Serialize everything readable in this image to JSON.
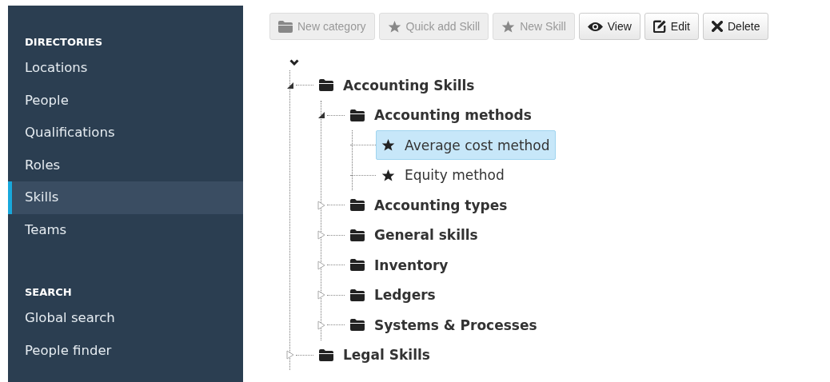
{
  "sidebar": {
    "sections": [
      {
        "heading": "DIRECTORIES",
        "items": [
          {
            "label": "Locations",
            "selected": false
          },
          {
            "label": "People",
            "selected": false
          },
          {
            "label": "Qualifications",
            "selected": false
          },
          {
            "label": "Roles",
            "selected": false
          },
          {
            "label": "Skills",
            "selected": true
          },
          {
            "label": "Teams",
            "selected": false
          }
        ]
      },
      {
        "heading": "SEARCH",
        "items": [
          {
            "label": "Global search",
            "selected": false
          },
          {
            "label": "People finder",
            "selected": false
          }
        ]
      }
    ]
  },
  "toolbar": {
    "buttons": [
      {
        "label": "New category",
        "kind": "new-category",
        "disabled": true
      },
      {
        "label": "Quick add Skill",
        "kind": "quick-add",
        "disabled": true
      },
      {
        "label": "New Skill",
        "kind": "new",
        "disabled": true
      },
      {
        "label": "View",
        "kind": "view",
        "disabled": false
      },
      {
        "label": "Edit",
        "kind": "edit",
        "disabled": false
      },
      {
        "label": "Delete",
        "kind": "delete",
        "disabled": false
      }
    ]
  },
  "tree": [
    {
      "label": "Accounting Skills",
      "kind": "category",
      "expanded": true,
      "selected": false,
      "children": [
        {
          "label": "Accounting methods",
          "kind": "category",
          "expanded": true,
          "selected": false,
          "children": [
            {
              "label": "Average cost method",
              "kind": "skill",
              "selected": true
            },
            {
              "label": "Equity method",
              "kind": "skill",
              "selected": false
            }
          ]
        },
        {
          "label": "Accounting types",
          "kind": "category",
          "expanded": false,
          "selected": false
        },
        {
          "label": "General skills",
          "kind": "category",
          "expanded": false,
          "selected": false
        },
        {
          "label": "Inventory",
          "kind": "category",
          "expanded": false,
          "selected": false
        },
        {
          "label": "Ledgers",
          "kind": "category",
          "expanded": false,
          "selected": false
        },
        {
          "label": "Systems & Processes",
          "kind": "category",
          "expanded": false,
          "selected": false
        }
      ]
    },
    {
      "label": "Legal Skills",
      "kind": "category",
      "expanded": false,
      "selected": false
    }
  ]
}
